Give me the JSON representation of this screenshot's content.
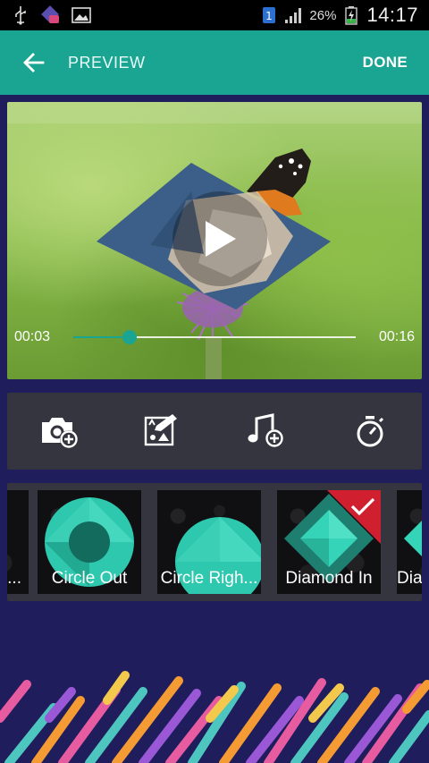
{
  "status_bar": {
    "sim": "1",
    "battery": "26%",
    "time": "14:17"
  },
  "appbar": {
    "title": "PREVIEW",
    "done": "DONE"
  },
  "player": {
    "current_time": "00:03",
    "total_time": "00:16",
    "progress_fraction": 0.2
  },
  "toolbar": {
    "items": [
      {
        "icon": "add-photo-icon"
      },
      {
        "icon": "edit-image-icon"
      },
      {
        "icon": "add-music-icon"
      },
      {
        "icon": "timer-icon"
      }
    ]
  },
  "transitions": {
    "items": [
      {
        "label": "...",
        "selected": false
      },
      {
        "label": "Circle Out",
        "selected": false
      },
      {
        "label": "Circle Righ...",
        "selected": false
      },
      {
        "label": "Diamond In",
        "selected": true
      },
      {
        "label": "Dia",
        "selected": false
      }
    ]
  },
  "colors": {
    "accent": "#1aa593",
    "background": "#1f1d5c",
    "panel": "#35353f",
    "selected_badge": "#d01f2e"
  }
}
